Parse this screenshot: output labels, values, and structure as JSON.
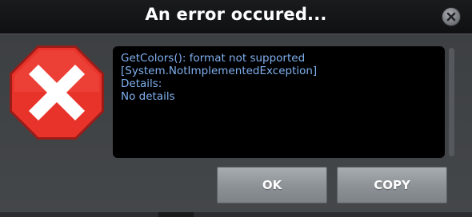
{
  "dialog": {
    "title": "An error occured...",
    "close_icon": "close-icon",
    "error_icon": "error-stop-sign-icon",
    "message": {
      "line1": "GetColors(): format not supported",
      "line2": "[System.NotImplementedException]",
      "details_label": "Details:",
      "details_value": "No details"
    },
    "buttons": {
      "ok_label": "OK",
      "copy_label": "COPY"
    },
    "colors": {
      "message_text": "#7fb0ef",
      "stop_sign_red": "#e8332b",
      "title_bar": "#121315"
    }
  }
}
